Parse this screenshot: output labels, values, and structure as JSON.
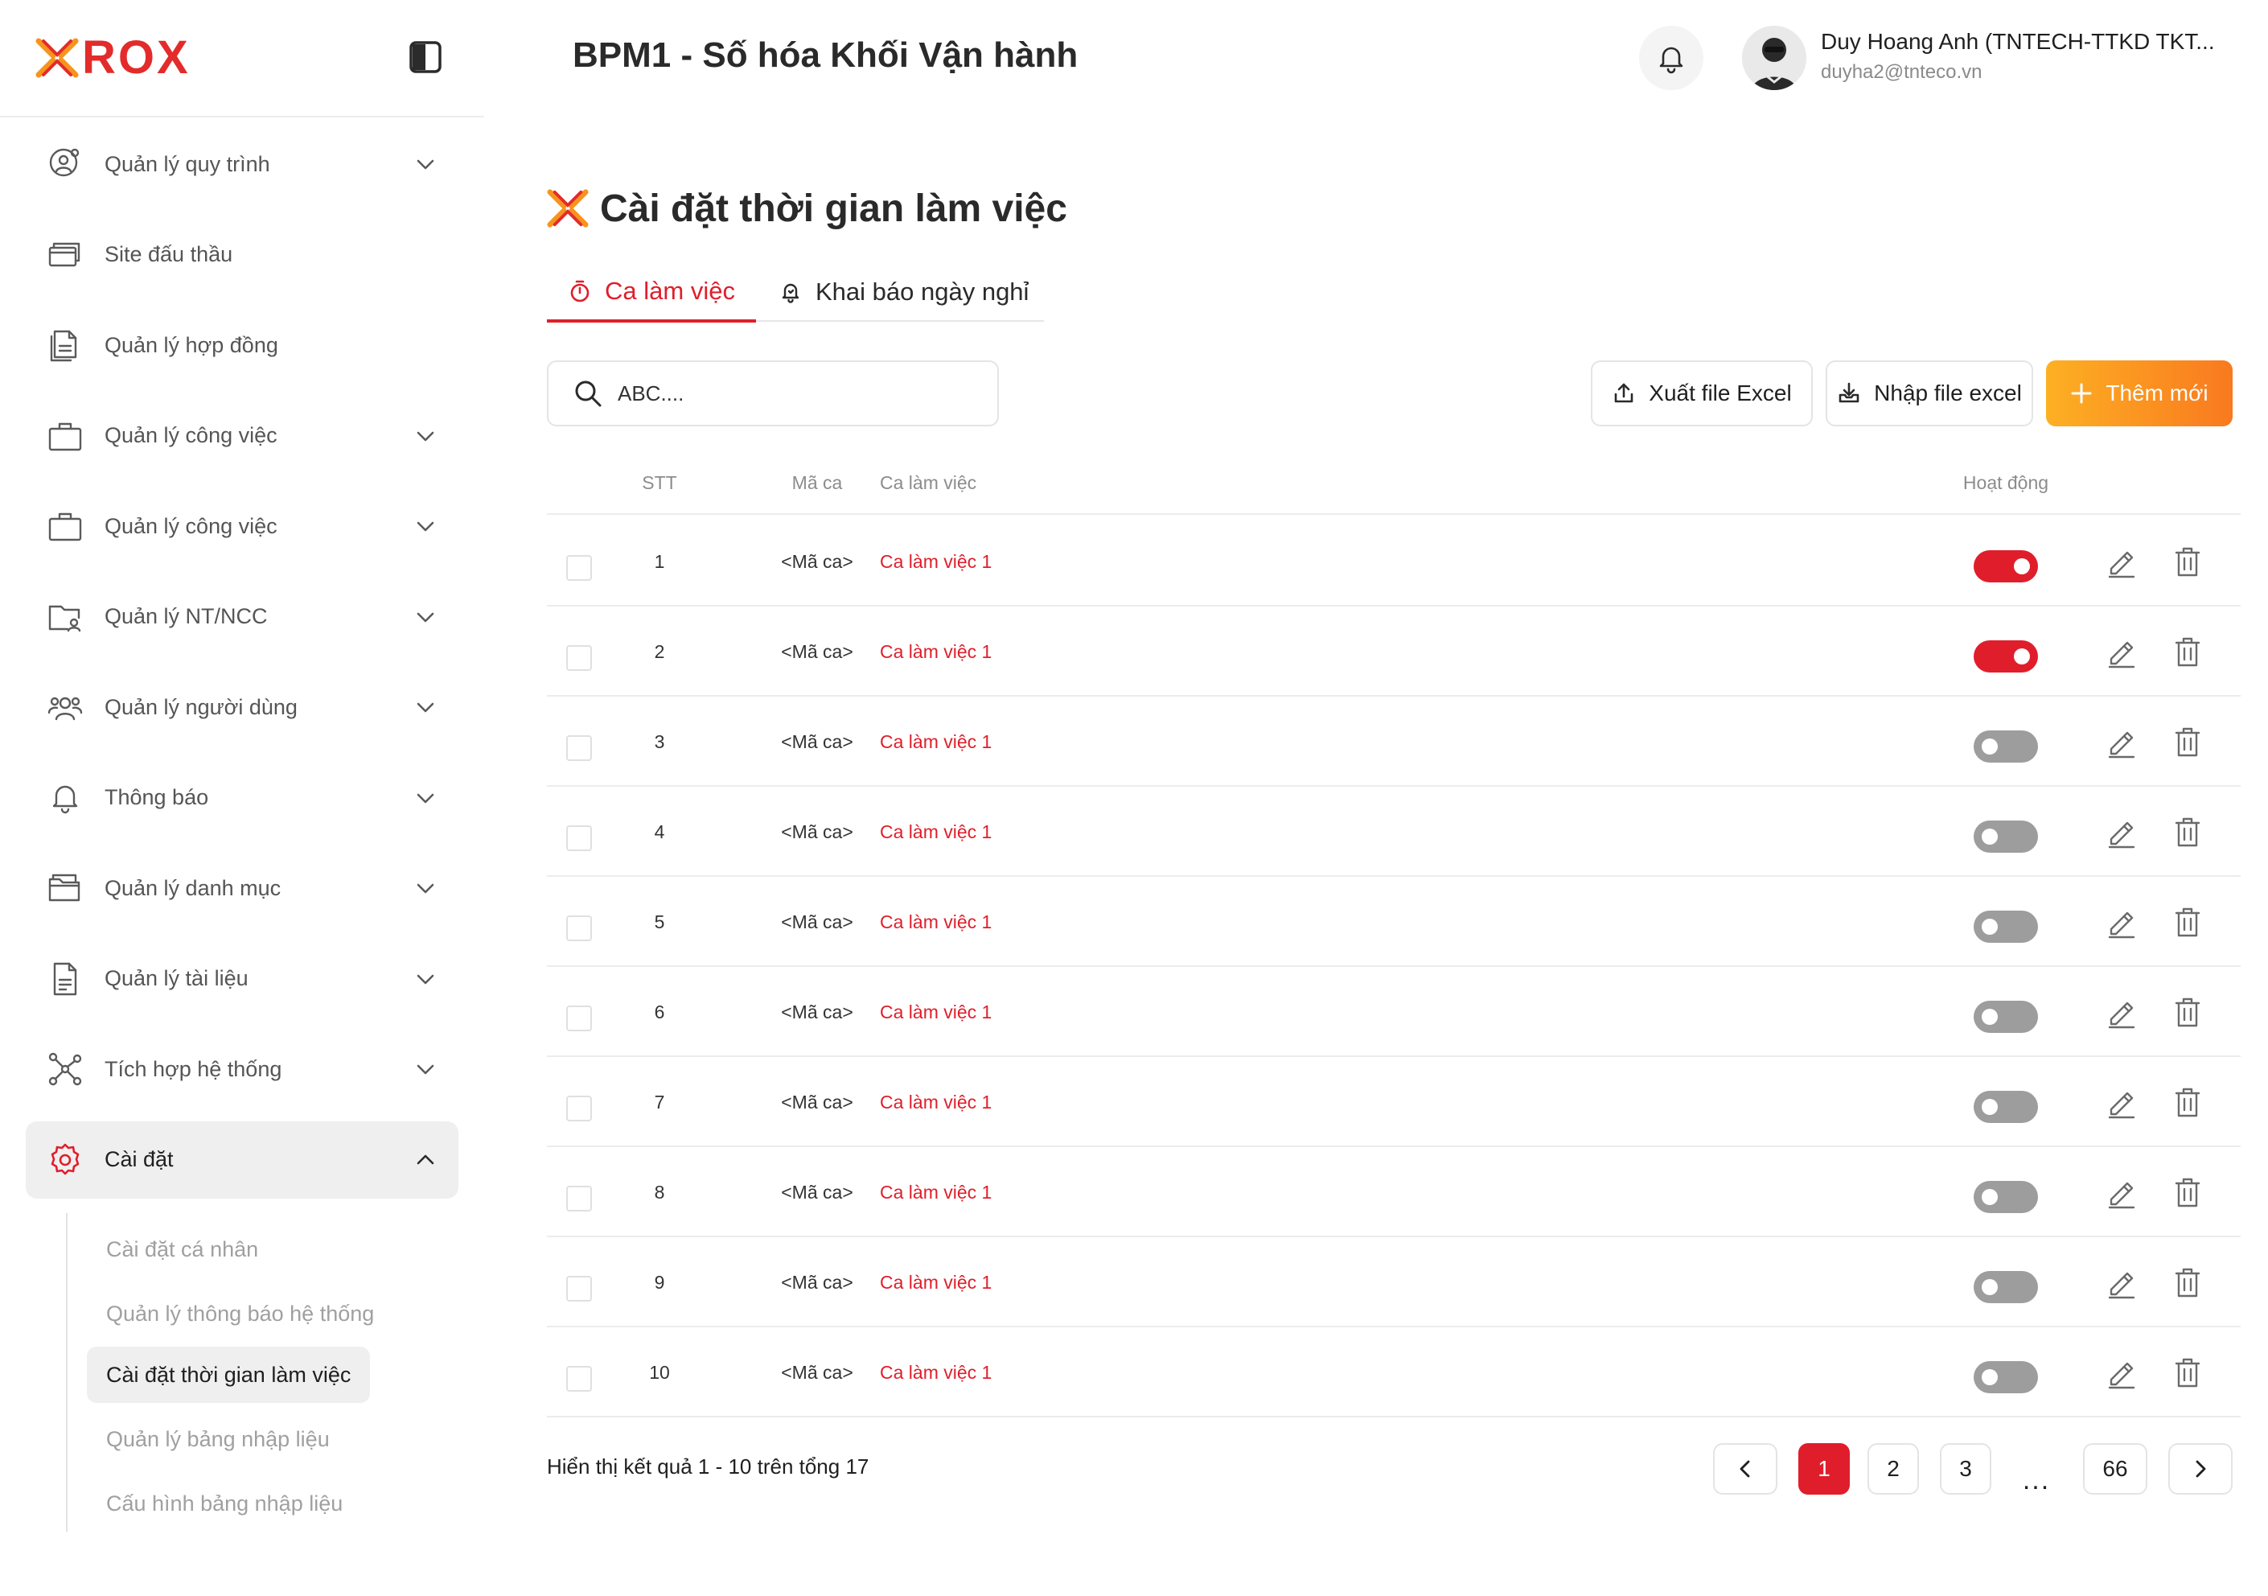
{
  "brand": {
    "logo_text": "ROX",
    "accent": "#e32b2b",
    "logo_mark_colors": [
      "#f7941d",
      "#e32b2b"
    ]
  },
  "header": {
    "title": "BPM1 - Số hóa Khối Vận hành",
    "notification_icon": "bell-icon",
    "user": {
      "name": "Duy Hoang Anh (TNTECH-TTKD TKT...",
      "email": "duyha2@tnteco.vn"
    }
  },
  "sidebar": {
    "items": [
      {
        "label": "Quản lý quy trình",
        "icon": "process-settings-icon",
        "has_children": true
      },
      {
        "label": "Site đấu thầu",
        "icon": "cards-icon",
        "has_children": false
      },
      {
        "label": "Quản lý hợp đồng",
        "icon": "document-copy-icon",
        "has_children": false
      },
      {
        "label": "Quản lý công việc",
        "icon": "briefcase-icon",
        "has_children": true
      },
      {
        "label": "Quản lý công việc",
        "icon": "briefcase-icon",
        "has_children": true
      },
      {
        "label": "Quản lý NT/NCC",
        "icon": "folder-user-icon",
        "has_children": true
      },
      {
        "label": "Quản lý người dùng",
        "icon": "users-icon",
        "has_children": true
      },
      {
        "label": "Thông báo",
        "icon": "bell-icon",
        "has_children": true
      },
      {
        "label": "Quản lý danh mục",
        "icon": "folders-icon",
        "has_children": true
      },
      {
        "label": "Quản lý tài liệu",
        "icon": "file-text-icon",
        "has_children": true
      },
      {
        "label": "Tích hợp hệ thống",
        "icon": "network-icon",
        "has_children": true
      },
      {
        "label": "Cài đặt",
        "icon": "gear-icon",
        "has_children": true,
        "expanded": true,
        "active": true
      }
    ],
    "submenu": [
      {
        "label": "Cài đặt cá nhân",
        "active": false
      },
      {
        "label": "Quản lý thông báo hệ thống",
        "active": false
      },
      {
        "label": "Cài đặt thời gian làm việc",
        "active": true
      },
      {
        "label": "Quản lý bảng nhập liệu",
        "active": false
      },
      {
        "label": "Cấu hình bảng nhập liệu",
        "active": false
      }
    ]
  },
  "page": {
    "title": "Cài đặt thời gian làm việc",
    "tabs": [
      {
        "label": "Ca làm việc",
        "icon": "stopwatch-icon",
        "active": true
      },
      {
        "label": "Khai báo ngày nghỉ",
        "icon": "bell-outline-icon",
        "active": false
      }
    ],
    "search": {
      "value": "",
      "placeholder": "ABC...."
    },
    "actions": {
      "export_label": "Xuất file Excel",
      "import_label": "Nhập file excel",
      "add_label": "Thêm mới"
    },
    "table": {
      "columns": {
        "stt": "STT",
        "code": "Mã ca",
        "shift": "Ca làm việc",
        "active": "Hoạt động"
      },
      "rows": [
        {
          "stt": "1",
          "code": "<Mã ca>",
          "shift": "Ca làm việc 1",
          "active": true
        },
        {
          "stt": "2",
          "code": "<Mã ca>",
          "shift": "Ca làm việc 1",
          "active": true
        },
        {
          "stt": "3",
          "code": "<Mã ca>",
          "shift": "Ca làm việc 1",
          "active": false
        },
        {
          "stt": "4",
          "code": "<Mã ca>",
          "shift": "Ca làm việc 1",
          "active": false
        },
        {
          "stt": "5",
          "code": "<Mã ca>",
          "shift": "Ca làm việc 1",
          "active": false
        },
        {
          "stt": "6",
          "code": "<Mã ca>",
          "shift": "Ca làm việc 1",
          "active": false
        },
        {
          "stt": "7",
          "code": "<Mã ca>",
          "shift": "Ca làm việc 1",
          "active": false
        },
        {
          "stt": "8",
          "code": "<Mã ca>",
          "shift": "Ca làm việc 1",
          "active": false
        },
        {
          "stt": "9",
          "code": "<Mã ca>",
          "shift": "Ca làm việc 1",
          "active": false
        },
        {
          "stt": "10",
          "code": "<Mã ca>",
          "shift": "Ca làm việc 1",
          "active": false
        }
      ]
    },
    "pagination": {
      "summary": "Hiển thị kết quả 1 - 10 trên tổng 17",
      "pages": [
        "1",
        "2",
        "3"
      ],
      "current": "1",
      "ellipsis": "...",
      "last": "66"
    }
  },
  "colors": {
    "primary": "#e01e2b",
    "add_gradient_start": "#fdb023",
    "add_gradient_end": "#f9791f",
    "toggle_off": "#9d9d9d"
  }
}
